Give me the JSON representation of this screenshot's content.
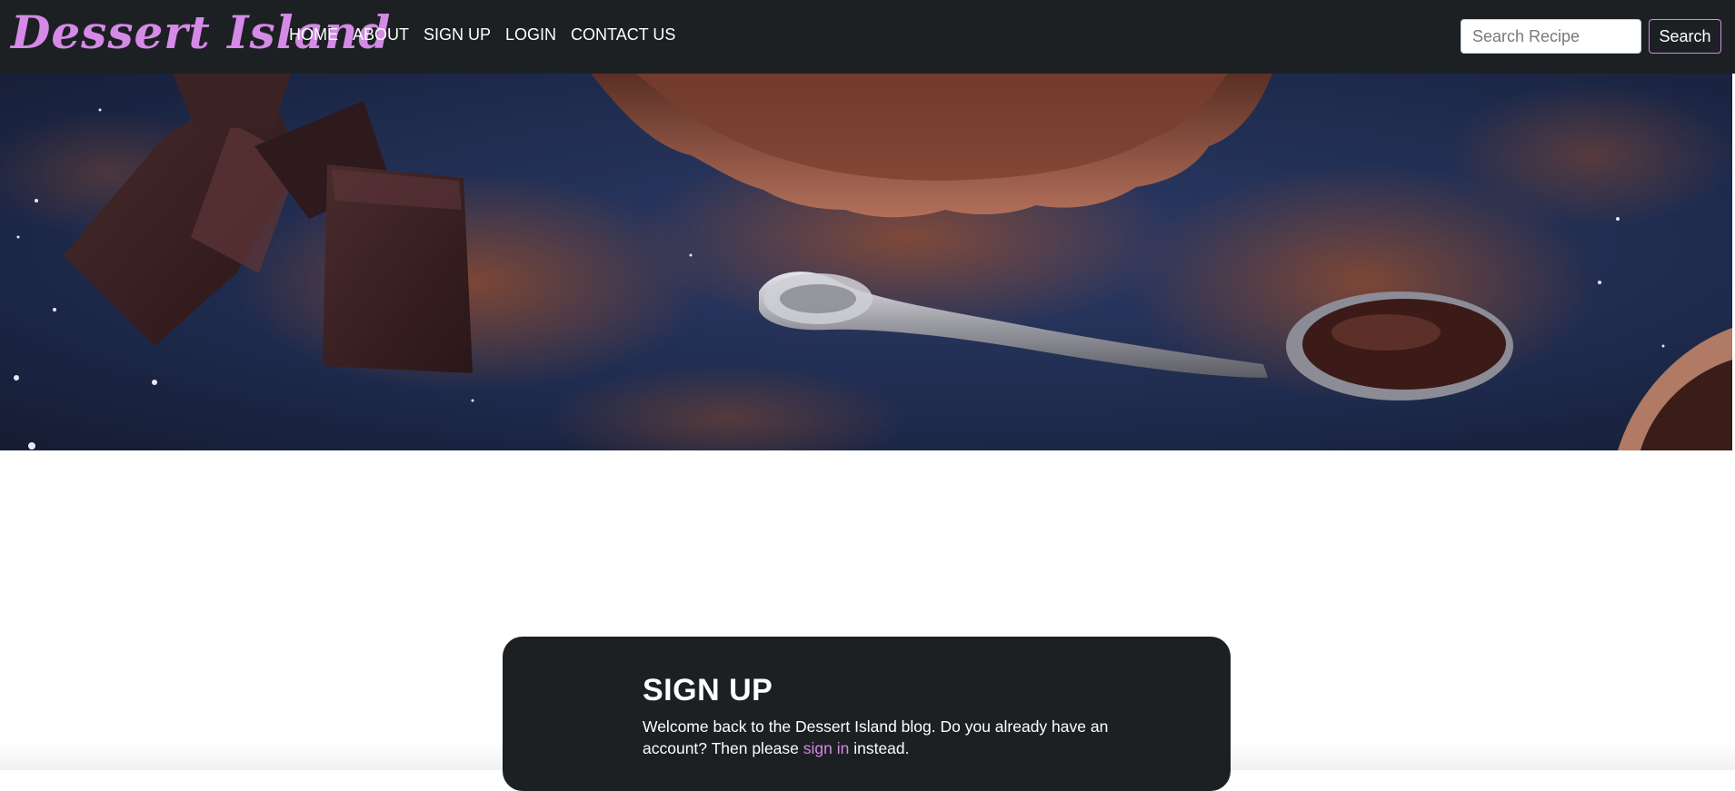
{
  "brand": {
    "name": "Dessert Island"
  },
  "nav": {
    "items": [
      {
        "label": "HOME"
      },
      {
        "label": "ABOUT"
      },
      {
        "label": "SIGN UP"
      },
      {
        "label": "LOGIN"
      },
      {
        "label": "CONTACT US"
      }
    ]
  },
  "search": {
    "placeholder": "Search Recipe",
    "value": "",
    "button_label": "Search"
  },
  "signup_card": {
    "title": "SIGN UP",
    "text_before": "Welcome back to the Dessert Island blog. Do you already have an account? Then please ",
    "link_label": "sign in",
    "text_after": " instead."
  },
  "colors": {
    "accent": "#d48ae6",
    "navbar_bg": "#1d2023",
    "card_bg": "#1d2023",
    "hero_bg": "#1b2440"
  }
}
